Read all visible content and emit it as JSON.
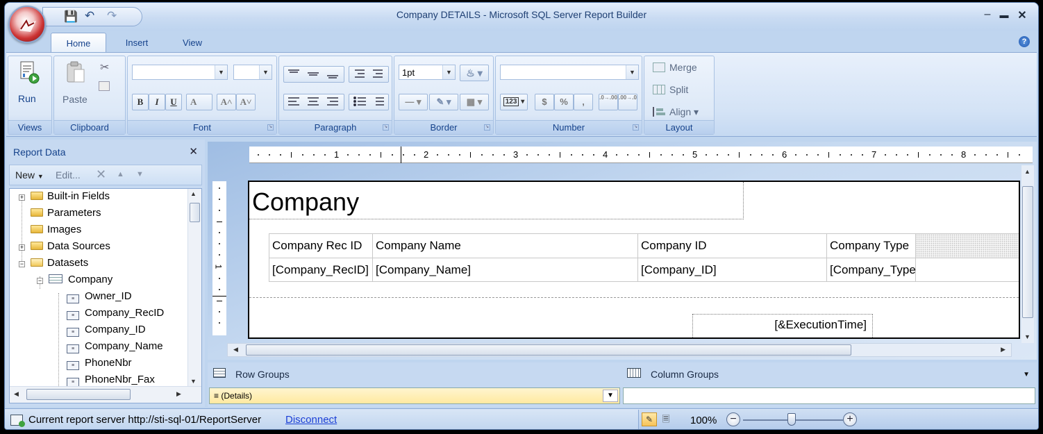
{
  "window": {
    "title": "Company DETAILS - Microsoft SQL Server Report Builder",
    "controls": [
      "minimize-icon",
      "maximize-icon",
      "close-icon"
    ]
  },
  "quick_access": [
    "save-icon",
    "undo-icon",
    "redo-icon"
  ],
  "tabs": [
    "Home",
    "Insert",
    "View"
  ],
  "active_tab": "Home",
  "ribbon": {
    "views": {
      "run_label": "Run",
      "group_label": "Views"
    },
    "clipboard": {
      "paste_label": "Paste",
      "group_label": "Clipboard"
    },
    "font": {
      "group_label": "Font",
      "buttons": [
        "B",
        "I",
        "U",
        "A",
        "A˄",
        "A˅"
      ]
    },
    "paragraph": {
      "group_label": "Paragraph"
    },
    "border": {
      "group_label": "Border",
      "width_value": "1pt"
    },
    "number": {
      "group_label": "Number",
      "buttons": [
        "123",
        "$",
        "%",
        ",",
        ".0→.00",
        ".00→.0"
      ]
    },
    "layout": {
      "group_label": "Layout",
      "merge_label": "Merge",
      "split_label": "Split",
      "align_label": "Align"
    }
  },
  "report_data": {
    "title": "Report Data",
    "toolbar": {
      "new_label": "New",
      "edit_label": "Edit..."
    },
    "tree": [
      {
        "label": "Built-in Fields",
        "kind": "folder",
        "expander": "+"
      },
      {
        "label": "Parameters",
        "kind": "folder"
      },
      {
        "label": "Images",
        "kind": "folder"
      },
      {
        "label": "Data Sources",
        "kind": "folder",
        "expander": "+"
      },
      {
        "label": "Datasets",
        "kind": "folder-open",
        "expander": "−"
      },
      {
        "label": "Company",
        "kind": "dataset",
        "expander": "−"
      },
      {
        "label": "Owner_ID",
        "kind": "field"
      },
      {
        "label": "Company_RecID",
        "kind": "field"
      },
      {
        "label": "Company_ID",
        "kind": "field"
      },
      {
        "label": "Company_Name",
        "kind": "field"
      },
      {
        "label": "PhoneNbr",
        "kind": "field"
      },
      {
        "label": "PhoneNbr_Fax",
        "kind": "field"
      }
    ]
  },
  "ruler": {
    "marks": [
      "1",
      "2",
      "3",
      "4",
      "5",
      "6",
      "7",
      "8"
    ],
    "vertical_mark": "1"
  },
  "report": {
    "title": "Company",
    "headers": [
      "Company Rec ID",
      "Company Name",
      "Company ID",
      "Company Type"
    ],
    "details": [
      "[Company_RecID]",
      "[Company_Name]",
      "[Company_ID]",
      "[Company_Type"
    ],
    "footer_expression": "[&ExecutionTime]"
  },
  "groups": {
    "row_groups_label": "Row Groups",
    "column_groups_label": "Column Groups",
    "row_group_item": "(Details)"
  },
  "status": {
    "server_text": "Current report server http://sti-sql-01/ReportServer",
    "disconnect_label": "Disconnect",
    "zoom": "100%"
  }
}
